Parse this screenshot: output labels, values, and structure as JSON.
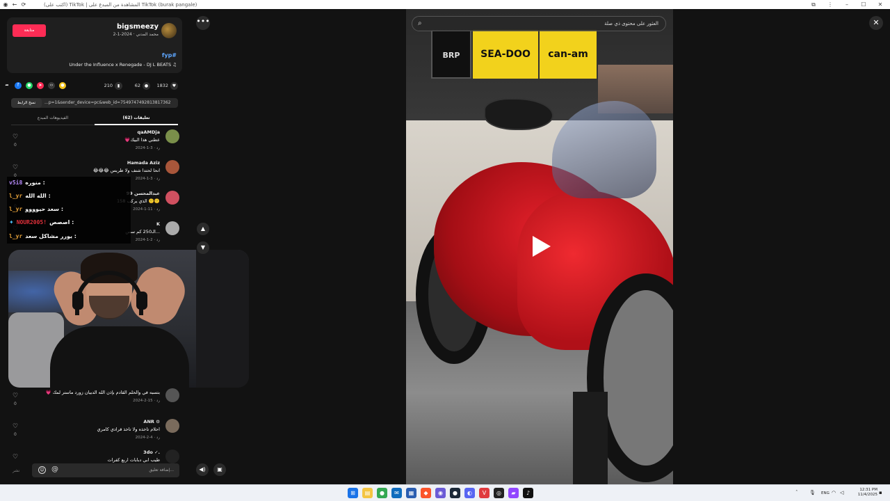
{
  "browser": {
    "title": "(اكتب على) TikTok | المشاهدة من المبدع على TikTok (burak pangale)",
    "back_icon": "←",
    "reload_icon": "⟳"
  },
  "creator": {
    "username": "bigsmeezy",
    "subtitle": "محمد المدني · 2024-1-2",
    "follow_label": "متابعة",
    "hashtag": "fyp#",
    "song": "Under the Influence x Renegade - DJ L BEATS ♫"
  },
  "actions": {
    "likes": "1832",
    "comments": "62",
    "saves": "210"
  },
  "link": {
    "url": "...p=1&sender_device=pc&web_id=7549747492813817362",
    "copy_label": "نسخ الرابط"
  },
  "tabs": {
    "comments": "تعليقات (62)",
    "creator_videos": "الفيديوهات المبدع"
  },
  "comments": [
    {
      "name": "qaAMDja",
      "text": "💗عطني هذا البيك",
      "date": "2024-1-3 · رد",
      "likes": "0",
      "color": "#7a8f4a"
    },
    {
      "name": "Hamada Aziz",
      "text": "😂😂😂 انحا لحتدا شنف ولا طربس",
      "date": "2024-1-3 · رد",
      "likes": "0",
      "color": "#a8563a"
    },
    {
      "name": "عبدالمحسن 99",
      "text": "158 الذي يركب 🙂🙂",
      "date": "2024-1-11 · رد",
      "likes": "0",
      "color": "#d05060"
    },
    {
      "name": "K",
      "text": "الـ250 كم سس...",
      "date": "2024-1-2 · رد",
      "likes": "0",
      "color": "#aaaaaa"
    },
    {
      "name": "",
      "text": "💗 بتسبه في والحلم القادم بإذن الله الدبيان زورد ماستر لمك",
      "date": "2024-2-15 · رد",
      "likes": "0",
      "color": "#555555"
    },
    {
      "name": "ANR ⚙",
      "text": "احلام تاخذه ولا تاخذ قرادي كامري",
      "date": "2024-2-4 · رد",
      "likes": "0",
      "color": "#7a6b5c"
    },
    {
      "name": "3do ✓.",
      "text": "طيب ابي دبابات اربع كفرات",
      "date": "",
      "likes": "0",
      "color": "#222222"
    }
  ],
  "input": {
    "placeholder": "إضافة تعليق...",
    "post_label": "نشر"
  },
  "chat": [
    {
      "user": "v5i8",
      "message": "منوره :",
      "user_color": "#b98cff",
      "badge": ""
    },
    {
      "user": "l_yr",
      "message": "الله الله :",
      "user_color": "#e8a33a",
      "badge": ""
    },
    {
      "user": "l_yr",
      "message": "سعد حيوووو :",
      "user_color": "#e8a33a",
      "badge": ""
    },
    {
      "user": "NOUR2005!",
      "message": "اصصص :",
      "user_color": "#e0303a",
      "badge": "✦"
    },
    {
      "user": "l_yr",
      "message": "يورر مشاكل سعد :",
      "user_color": "#e8a33a",
      "badge": ""
    }
  ],
  "video": {
    "search_placeholder": "العثور على محتوى ذي صلة",
    "brands": [
      "BRP",
      "SEA-DOO",
      "can-am"
    ]
  },
  "taskbar": {
    "lang": "ENG",
    "time": "12:31 PM",
    "date": "11/4/2025"
  },
  "colors": {
    "accent": "#fe2c55",
    "hashtag": "#5ea7ff",
    "bike_red": "#d61c24"
  }
}
